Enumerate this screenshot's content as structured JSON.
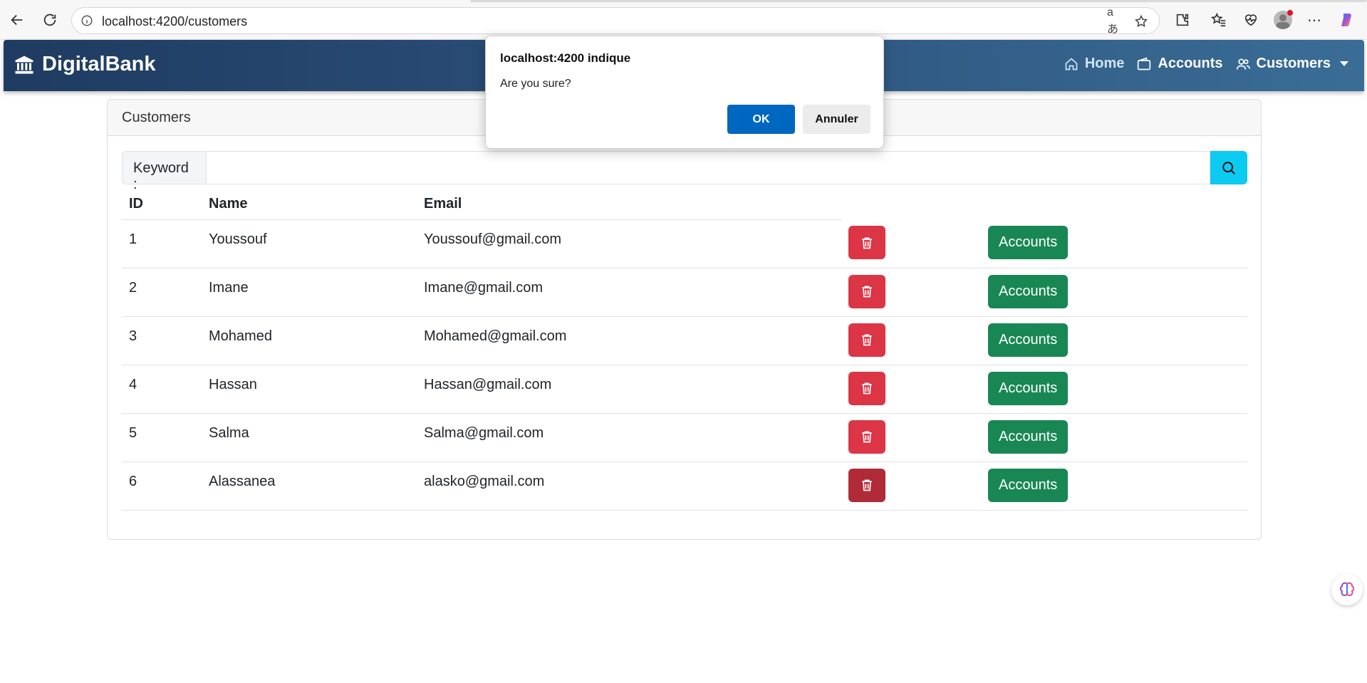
{
  "browser": {
    "url": "localhost:4200/customers",
    "icons": [
      "back-icon",
      "reload-icon",
      "info-icon",
      "read-aloud-icon",
      "favorite-star-icon",
      "extensions-icon",
      "favorites-icon",
      "browser-essentials-icon",
      "profile-avatar-icon",
      "more-icon",
      "copilot-icon"
    ]
  },
  "navbar": {
    "brand": "DigitalBank",
    "links": {
      "home": "Home",
      "accounts": "Accounts",
      "customers": "Customers"
    }
  },
  "card": {
    "header": "Customers",
    "search": {
      "label": "Keyword :",
      "value": "",
      "placeholder": ""
    },
    "table": {
      "columns": [
        "ID",
        "Name",
        "Email"
      ],
      "rows": [
        {
          "id": "1",
          "name": "Youssouf",
          "email": "Youssouf@gmail.com",
          "accounts_label": "Accounts"
        },
        {
          "id": "2",
          "name": "Imane",
          "email": "Imane@gmail.com",
          "accounts_label": "Accounts"
        },
        {
          "id": "3",
          "name": "Mohamed",
          "email": "Mohamed@gmail.com",
          "accounts_label": "Accounts"
        },
        {
          "id": "4",
          "name": "Hassan",
          "email": "Hassan@gmail.com",
          "accounts_label": "Accounts"
        },
        {
          "id": "5",
          "name": "Salma",
          "email": "Salma@gmail.com",
          "accounts_label": "Accounts"
        },
        {
          "id": "6",
          "name": "Alassanea",
          "email": "alasko@gmail.com",
          "accounts_label": "Accounts"
        }
      ]
    }
  },
  "dialog": {
    "title": "localhost:4200 indique",
    "message": "Are you sure?",
    "ok_label": "OK",
    "cancel_label": "Annuler"
  },
  "colors": {
    "navbar_start": "#1f3b61",
    "navbar_end": "#3a6d96",
    "danger": "#dc3545",
    "success": "#198754",
    "info": "#0dcaf0",
    "dialog_primary": "#0067c0"
  }
}
